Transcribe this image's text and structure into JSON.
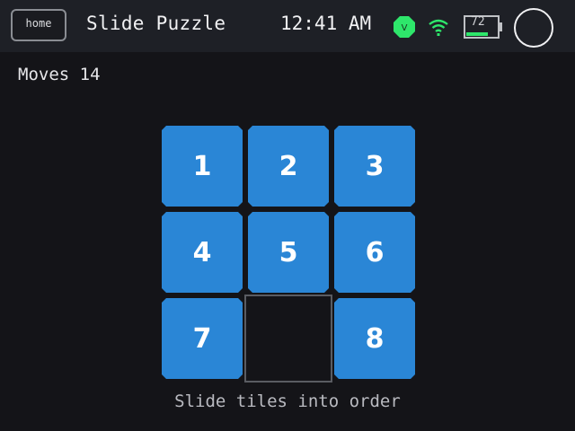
{
  "topbar": {
    "home_label": "home",
    "app_title": "Slide Puzzle",
    "time": "12:41 AM",
    "vpn_badge": "V",
    "battery_level": "72",
    "icons": [
      "vpn-icon",
      "wifi-icon",
      "battery-icon",
      "power-circle-icon"
    ],
    "colors": {
      "status_green": "#2ee66b",
      "accent": "#2a86d6"
    }
  },
  "game": {
    "moves_label": "Moves",
    "moves_count": "14",
    "tiles": [
      "1",
      "2",
      "3",
      "4",
      "5",
      "6",
      "7",
      "",
      "8"
    ],
    "hint": "Slide tiles into order"
  }
}
